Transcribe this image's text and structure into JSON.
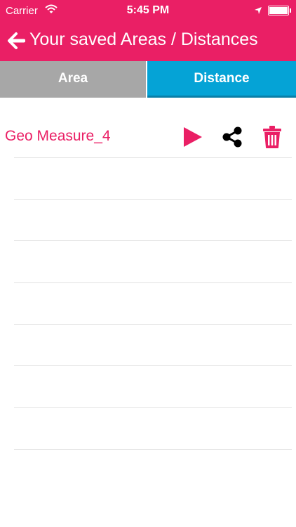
{
  "status_bar": {
    "carrier": "Carrier",
    "time": "5:45 PM"
  },
  "header": {
    "title": "Your saved Areas / Distances",
    "color": "#ea1f65"
  },
  "tabs": [
    {
      "label": "Area",
      "selected": false,
      "color": "#a7a7a7"
    },
    {
      "label": "Distance",
      "selected": true,
      "color": "#05a3d6"
    }
  ],
  "saved_items": [
    {
      "name": "Geo Measure_4",
      "actions": [
        "play-icon",
        "share-icon",
        "trash-icon"
      ]
    }
  ]
}
